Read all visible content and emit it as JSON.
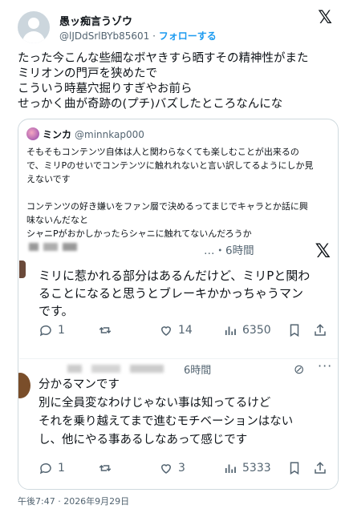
{
  "header": {
    "display_name": "愚ッ痴言うゾウ",
    "handle": "@lJDdSrlBYb85601",
    "separator": " · ",
    "follow_label": "フォローする",
    "logo_icon": "x-logo-icon"
  },
  "post": {
    "lines": [
      "たった今こんな些細なボヤきすら晒すその精神性がまた",
      "ミリオンの門戸を狭めたで",
      "こういう時墓穴掘りすぎやお前ら",
      "せっかく曲が奇跡の(プチ)バズしたところなんにな"
    ]
  },
  "quote": {
    "name": "ミンカ",
    "handle": "@minnkap000",
    "lines": [
      "そもそもコンテンツ自体は人と関わらなくても楽しむことが出来るの",
      "で、ミリPのせいでコンテンツに触れれないと言い訳してるようにしか見",
      "えないです",
      "",
      "コンテンツの好き嫌いをファン層で決めるってまじでキャラとか話に興",
      "味ないんだなと",
      "シャニPがおかしかったらシャニに触れてないんだろうか"
    ],
    "screenshot": {
      "tweet1": {
        "time": "…・6時間",
        "lines": [
          "ミリに惹かれる部分はあるんだけど、ミリPと関わ",
          "ることになると思うとブレーキかかっちゃうマン",
          "です。"
        ],
        "replies": "1",
        "retweets": "",
        "likes": "14",
        "views": "6350"
      },
      "tweet2": {
        "time": "6時間",
        "lines": [
          "分かるマンです",
          "別に全員変なわけじゃない事は知ってるけど",
          "それを乗り越えてまで進むモチベーションはない",
          "し、他にやる事あるしなあって感じです"
        ],
        "replies": "1",
        "retweets": "",
        "likes": "3",
        "views": "5333"
      }
    }
  },
  "timestamp": "午後7:47 · 2026年9月29日"
}
